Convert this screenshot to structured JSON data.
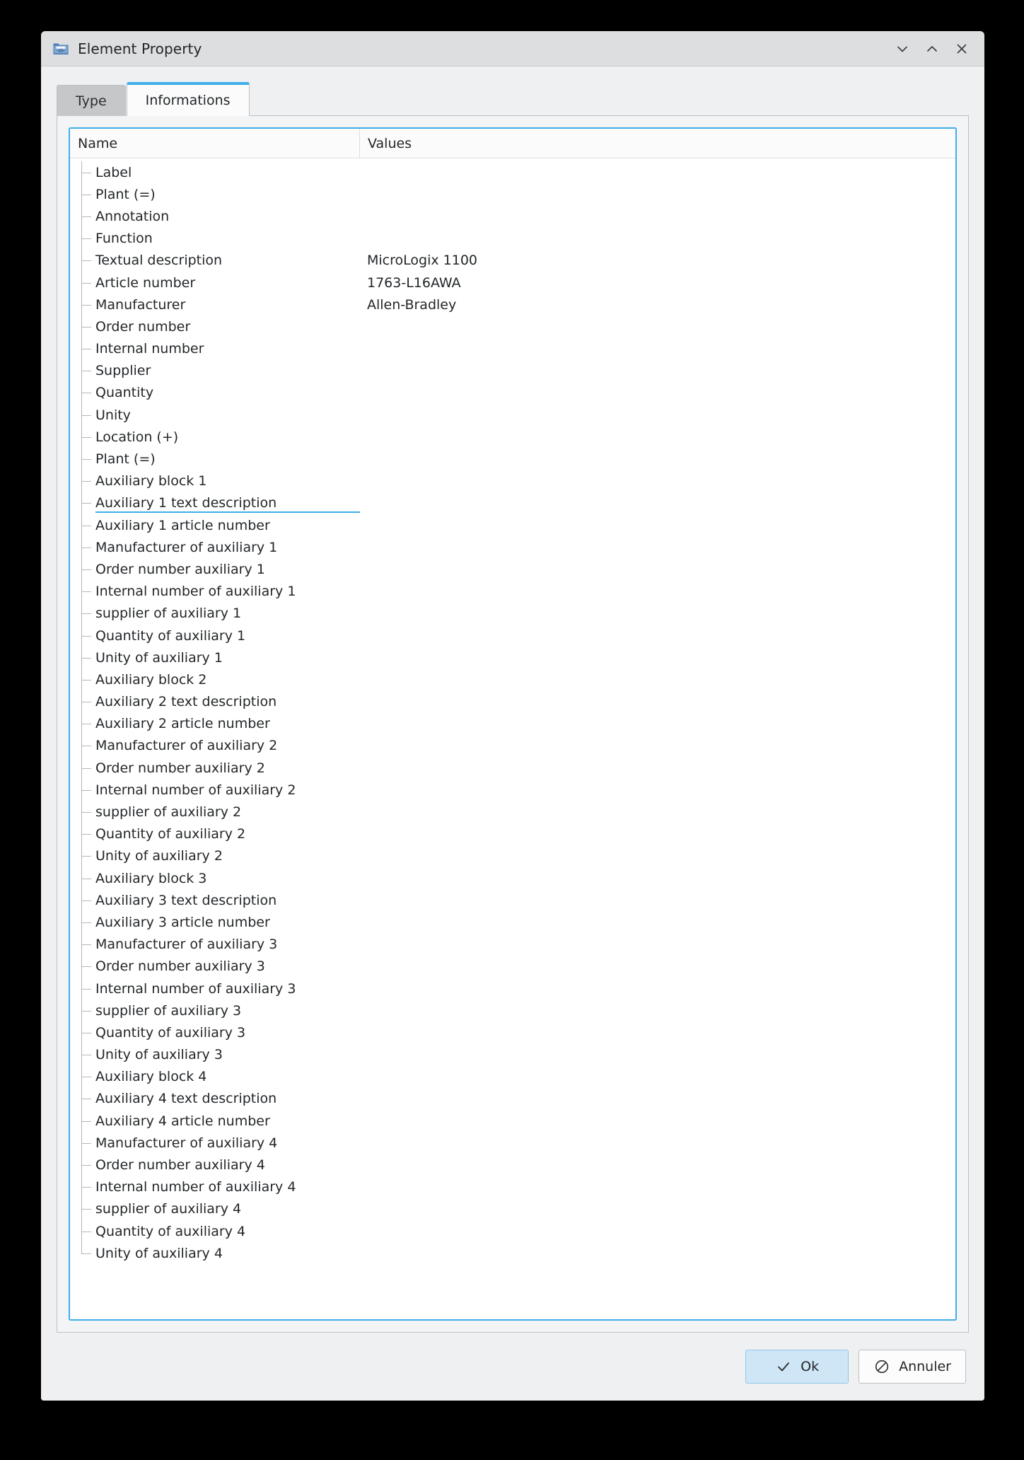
{
  "window": {
    "title": "Element Property",
    "icon": "folder-schematic-icon",
    "controls": [
      {
        "name": "minimize-button",
        "icon": "chevron-down-icon",
        "glyph": "∨"
      },
      {
        "name": "maximize-button",
        "icon": "chevron-up-icon",
        "glyph": "∧"
      },
      {
        "name": "close-button",
        "icon": "close-icon",
        "glyph": "✕"
      }
    ]
  },
  "tabs": [
    {
      "label": "Type",
      "active": false
    },
    {
      "label": "Informations",
      "active": true
    }
  ],
  "table": {
    "columns": [
      "Name",
      "Values"
    ],
    "rows": [
      {
        "name": "Label",
        "value": ""
      },
      {
        "name": "Plant (=)",
        "value": ""
      },
      {
        "name": "Annotation",
        "value": ""
      },
      {
        "name": "Function",
        "value": ""
      },
      {
        "name": "Textual description",
        "value": "MicroLogix 1100"
      },
      {
        "name": "Article number",
        "value": "1763-L16AWA"
      },
      {
        "name": "Manufacturer",
        "value": "Allen-Bradley"
      },
      {
        "name": "Order number",
        "value": ""
      },
      {
        "name": "Internal number",
        "value": ""
      },
      {
        "name": "Supplier",
        "value": ""
      },
      {
        "name": "Quantity",
        "value": ""
      },
      {
        "name": "Unity",
        "value": ""
      },
      {
        "name": "Location (+)",
        "value": ""
      },
      {
        "name": "Plant (=)",
        "value": ""
      },
      {
        "name": "Auxiliary block 1",
        "value": ""
      },
      {
        "name": "Auxiliary 1 text description",
        "value": "",
        "editing": true
      },
      {
        "name": "Auxiliary 1 article number",
        "value": ""
      },
      {
        "name": "Manufacturer of auxiliary 1",
        "value": ""
      },
      {
        "name": "Order number auxiliary 1",
        "value": ""
      },
      {
        "name": "Internal number of auxiliary 1",
        "value": ""
      },
      {
        "name": "supplier of auxiliary 1",
        "value": ""
      },
      {
        "name": "Quantity of auxiliary 1",
        "value": ""
      },
      {
        "name": "Unity of auxiliary 1",
        "value": ""
      },
      {
        "name": "Auxiliary block 2",
        "value": ""
      },
      {
        "name": "Auxiliary 2 text description",
        "value": ""
      },
      {
        "name": "Auxiliary 2 article number",
        "value": ""
      },
      {
        "name": "Manufacturer of auxiliary 2",
        "value": ""
      },
      {
        "name": "Order number auxiliary 2",
        "value": ""
      },
      {
        "name": "Internal number of auxiliary 2",
        "value": ""
      },
      {
        "name": "supplier of auxiliary 2",
        "value": ""
      },
      {
        "name": "Quantity of auxiliary 2",
        "value": ""
      },
      {
        "name": "Unity of auxiliary 2",
        "value": ""
      },
      {
        "name": "Auxiliary block 3",
        "value": ""
      },
      {
        "name": "Auxiliary 3 text description",
        "value": ""
      },
      {
        "name": "Auxiliary 3 article number",
        "value": ""
      },
      {
        "name": "Manufacturer of auxiliary 3",
        "value": ""
      },
      {
        "name": "Order number auxiliary 3",
        "value": ""
      },
      {
        "name": "Internal number of auxiliary 3",
        "value": ""
      },
      {
        "name": "supplier of auxiliary 3",
        "value": ""
      },
      {
        "name": "Quantity of auxiliary 3",
        "value": ""
      },
      {
        "name": "Unity of auxiliary 3",
        "value": ""
      },
      {
        "name": "Auxiliary block 4",
        "value": ""
      },
      {
        "name": "Auxiliary 4 text description",
        "value": ""
      },
      {
        "name": "Auxiliary 4 article number",
        "value": ""
      },
      {
        "name": "Manufacturer of auxiliary 4",
        "value": ""
      },
      {
        "name": "Order number auxiliary 4",
        "value": ""
      },
      {
        "name": "Internal number of auxiliary 4",
        "value": ""
      },
      {
        "name": "supplier of auxiliary 4",
        "value": ""
      },
      {
        "name": "Quantity of auxiliary 4",
        "value": ""
      },
      {
        "name": "Unity of auxiliary 4",
        "value": ""
      }
    ]
  },
  "footer": {
    "ok_label": "Ok",
    "ok_icon": "check-icon",
    "cancel_label": "Annuler",
    "cancel_icon": "no-entry-icon"
  },
  "colors": {
    "accent": "#3daee9",
    "window_bg": "#eff0f1",
    "titlebar_bg": "#dcdee0",
    "tab_inactive_bg": "#c5c7c9",
    "tab_active_bg": "#fbfbfb",
    "text": "#232629",
    "tree_line": "#b4b6b8",
    "primary_button_bg": "#cfe6f7"
  }
}
